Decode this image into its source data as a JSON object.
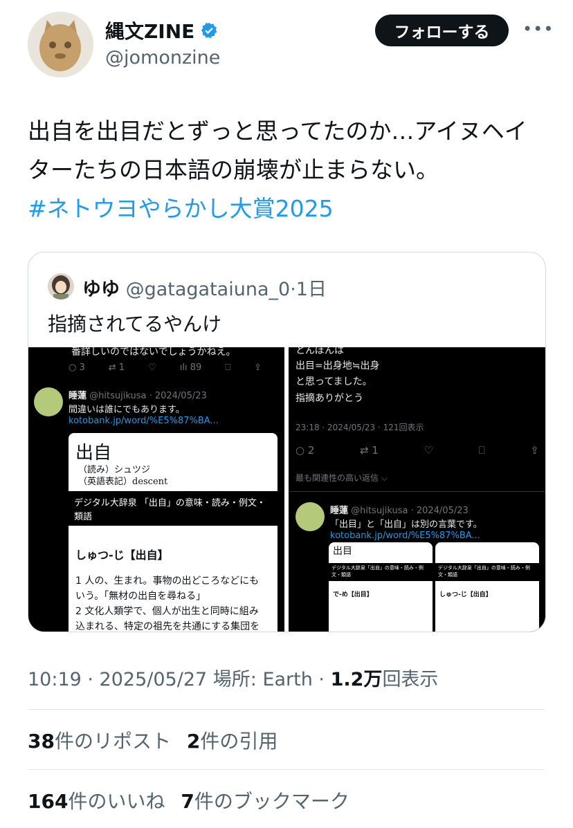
{
  "author": {
    "name": "縄文ZINE",
    "handle": "@jomonzine",
    "follow_label": "フォローする",
    "more_label": "•••"
  },
  "tweet": {
    "line1": "出自を出目だとずっと思ってたのか…アイヌヘイ",
    "line2": "ターたちの日本語の崩壊が止まらない。",
    "hashtag": "#ネトウヨやらかし大賞2025"
  },
  "quote": {
    "name": "ゆゆ",
    "handle": "@gatagataiuna_0",
    "time": "·1日",
    "text": "指摘されてるやんけ"
  },
  "screenshot_left": {
    "top_text": "番詳しいのではないでしょうかねえ。",
    "counts": [
      "3",
      "1",
      "",
      "89"
    ],
    "reply_name": "睡蓮",
    "reply_handle": "@hitsujikusa · 2024/05/23",
    "reply_text": "間違いは誰にでもあります。",
    "reply_link": "kotobank.jp/word/%E5%87%BA...",
    "dict_title": "出自",
    "dict_reading": "（読み）シュツジ",
    "dict_english": "（英語表記）descent",
    "dict_source": "デジタル大辞泉 「出自」の意味・読み・例文・類語",
    "dict_head": "しゅつ‐じ【出自】",
    "dict_def1": "1 人の、生まれ。事物の出どころなどにも",
    "dict_def2": "いう。「無材の出自を尋ねる」",
    "dict_def3": "2 文化人類学で、個人が出生と同時に組み",
    "dict_def4": "込まれる、特定の祖先を共通にする集団を"
  },
  "screenshot_right": {
    "top_text1": "とんぼんは",
    "top_text2": "出目=出身地≒出身",
    "top_text3": "と思ってました。",
    "top_text4": "指摘ありがとう",
    "time": "23:18 · 2024/05/23 · 121回表示",
    "counts": [
      "2",
      "1"
    ],
    "relevant": "最も関連性の高い返信",
    "reply_name": "睡蓮",
    "reply_handle": "@hitsujikusa · 2024/05/23",
    "reply_text": "「出目」と「出自」は別の言葉です。",
    "reply_link": "kotobank.jp/word/%E5%87%BA...",
    "card1_title": "出目",
    "card1_head": "で‐め【出目】",
    "card2_head": "しゅつ‐じ【出自】",
    "card_source": "デジタル大辞泉「出自」の意味・読み・例文・類語"
  },
  "meta": {
    "time": "10:19 · 2025/05/27 場所: Earth · ",
    "views_count": "1.2万",
    "views_label": "回表示"
  },
  "stats": {
    "reposts_count": "38",
    "reposts_label": "件のリポスト",
    "quotes_count": "2",
    "quotes_label": "件の引用",
    "likes_count": "164",
    "likes_label": "件のいいね",
    "bookmarks_count": "7",
    "bookmarks_label": "件のブックマーク"
  },
  "colors": {
    "link": "#1d9bf0",
    "muted": "#536471",
    "text": "#0f1419",
    "verified": "#1d9bf0"
  }
}
